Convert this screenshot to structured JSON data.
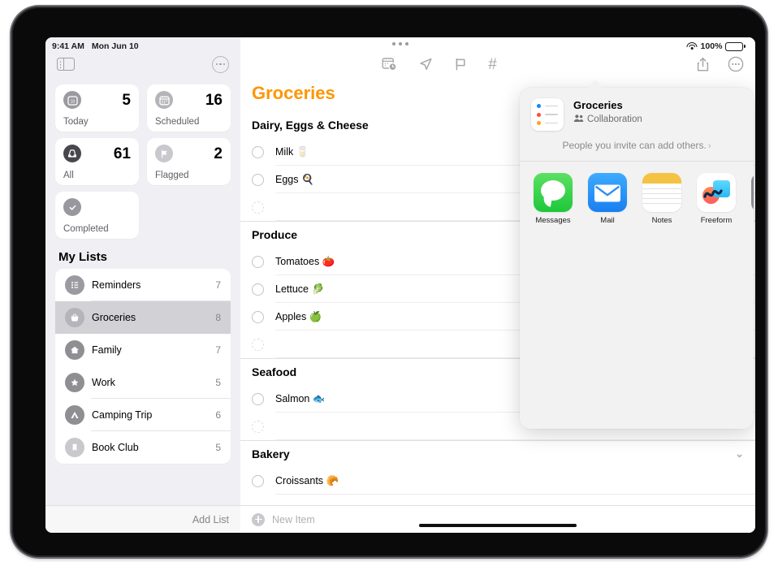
{
  "status_bar": {
    "time": "9:41 AM",
    "date": "Mon Jun 10",
    "wifi_icon": "wifi-icon",
    "battery_percent": "100%",
    "battery_icon": "battery-full-icon"
  },
  "sidebar": {
    "toggle_icon": "sidebar-toggle-icon",
    "more_icon": "ellipsis-circle-icon",
    "smart_lists": [
      {
        "key": "today",
        "label": "Today",
        "count": "5",
        "icon": "calendar-day-icon"
      },
      {
        "key": "scheduled",
        "label": "Scheduled",
        "count": "16",
        "icon": "calendar-icon"
      },
      {
        "key": "all",
        "label": "All",
        "count": "61",
        "icon": "inbox-tray-icon"
      },
      {
        "key": "flagged",
        "label": "Flagged",
        "count": "2",
        "icon": "flag-icon"
      },
      {
        "key": "completed",
        "label": "Completed",
        "count": "",
        "icon": "checkmark-circle-icon"
      }
    ],
    "my_lists_header": "My Lists",
    "lists": [
      {
        "label": "Reminders",
        "count": "7",
        "icon": "list-bullet-icon",
        "color": "#9a9aa0",
        "selected": false
      },
      {
        "label": "Groceries",
        "count": "8",
        "icon": "basket-icon",
        "color": "#b4b4ba",
        "selected": true
      },
      {
        "label": "Family",
        "count": "7",
        "icon": "house-icon",
        "color": "#8e8e93",
        "selected": false
      },
      {
        "label": "Work",
        "count": "5",
        "icon": "star-icon",
        "color": "#8e8e93",
        "selected": false
      },
      {
        "label": "Camping Trip",
        "count": "6",
        "icon": "tent-icon",
        "color": "#8e8e93",
        "selected": false
      },
      {
        "label": "Book Club",
        "count": "5",
        "icon": "bookmark-icon",
        "color": "#c8c8cd",
        "selected": false
      }
    ],
    "add_list_label": "Add List"
  },
  "toolbar": {
    "left_icons": [
      {
        "name": "calendar-badge-clock-icon"
      },
      {
        "name": "location-arrow-icon"
      },
      {
        "name": "flag-icon"
      },
      {
        "name": "hashtag-icon",
        "glyph": "#"
      }
    ],
    "right_icons": [
      {
        "name": "share-icon"
      },
      {
        "name": "ellipsis-circle-icon"
      }
    ]
  },
  "detail": {
    "title": "Groceries",
    "title_color": "#ff9500",
    "sections": [
      {
        "name": "Dairy, Eggs & Cheese",
        "collapsible": false,
        "items": [
          {
            "text": "Milk 🥛"
          },
          {
            "text": "Eggs 🍳"
          }
        ]
      },
      {
        "name": "Produce",
        "collapsible": false,
        "items": [
          {
            "text": "Tomatoes 🍅"
          },
          {
            "text": "Lettuce 🥬"
          },
          {
            "text": "Apples 🍏"
          }
        ]
      },
      {
        "name": "Seafood",
        "collapsible": false,
        "items": [
          {
            "text": "Salmon 🐟"
          }
        ]
      },
      {
        "name": "Bakery",
        "collapsible": true,
        "chevron": "⌄",
        "items": [
          {
            "text": "Croissants 🥐"
          }
        ]
      }
    ],
    "new_item_placeholder": "New Item",
    "new_item_icon": "plus-circle-icon"
  },
  "share_popover": {
    "title": "Groceries",
    "subtitle": "Collaboration",
    "subtitle_icon": "people-icon",
    "note": "People you invite can add others.",
    "note_chevron": "›",
    "thumbnail_icon": "reminders-list-thumbnail",
    "apps": [
      {
        "name": "Messages",
        "icon": "messages-app-icon"
      },
      {
        "name": "Mail",
        "icon": "mail-app-icon"
      },
      {
        "name": "Notes",
        "icon": "notes-app-icon"
      },
      {
        "name": "Freeform",
        "icon": "freeform-app-icon"
      },
      {
        "name": "wi",
        "icon": "more-apps-icon"
      }
    ]
  },
  "home_indicator": "home-indicator"
}
